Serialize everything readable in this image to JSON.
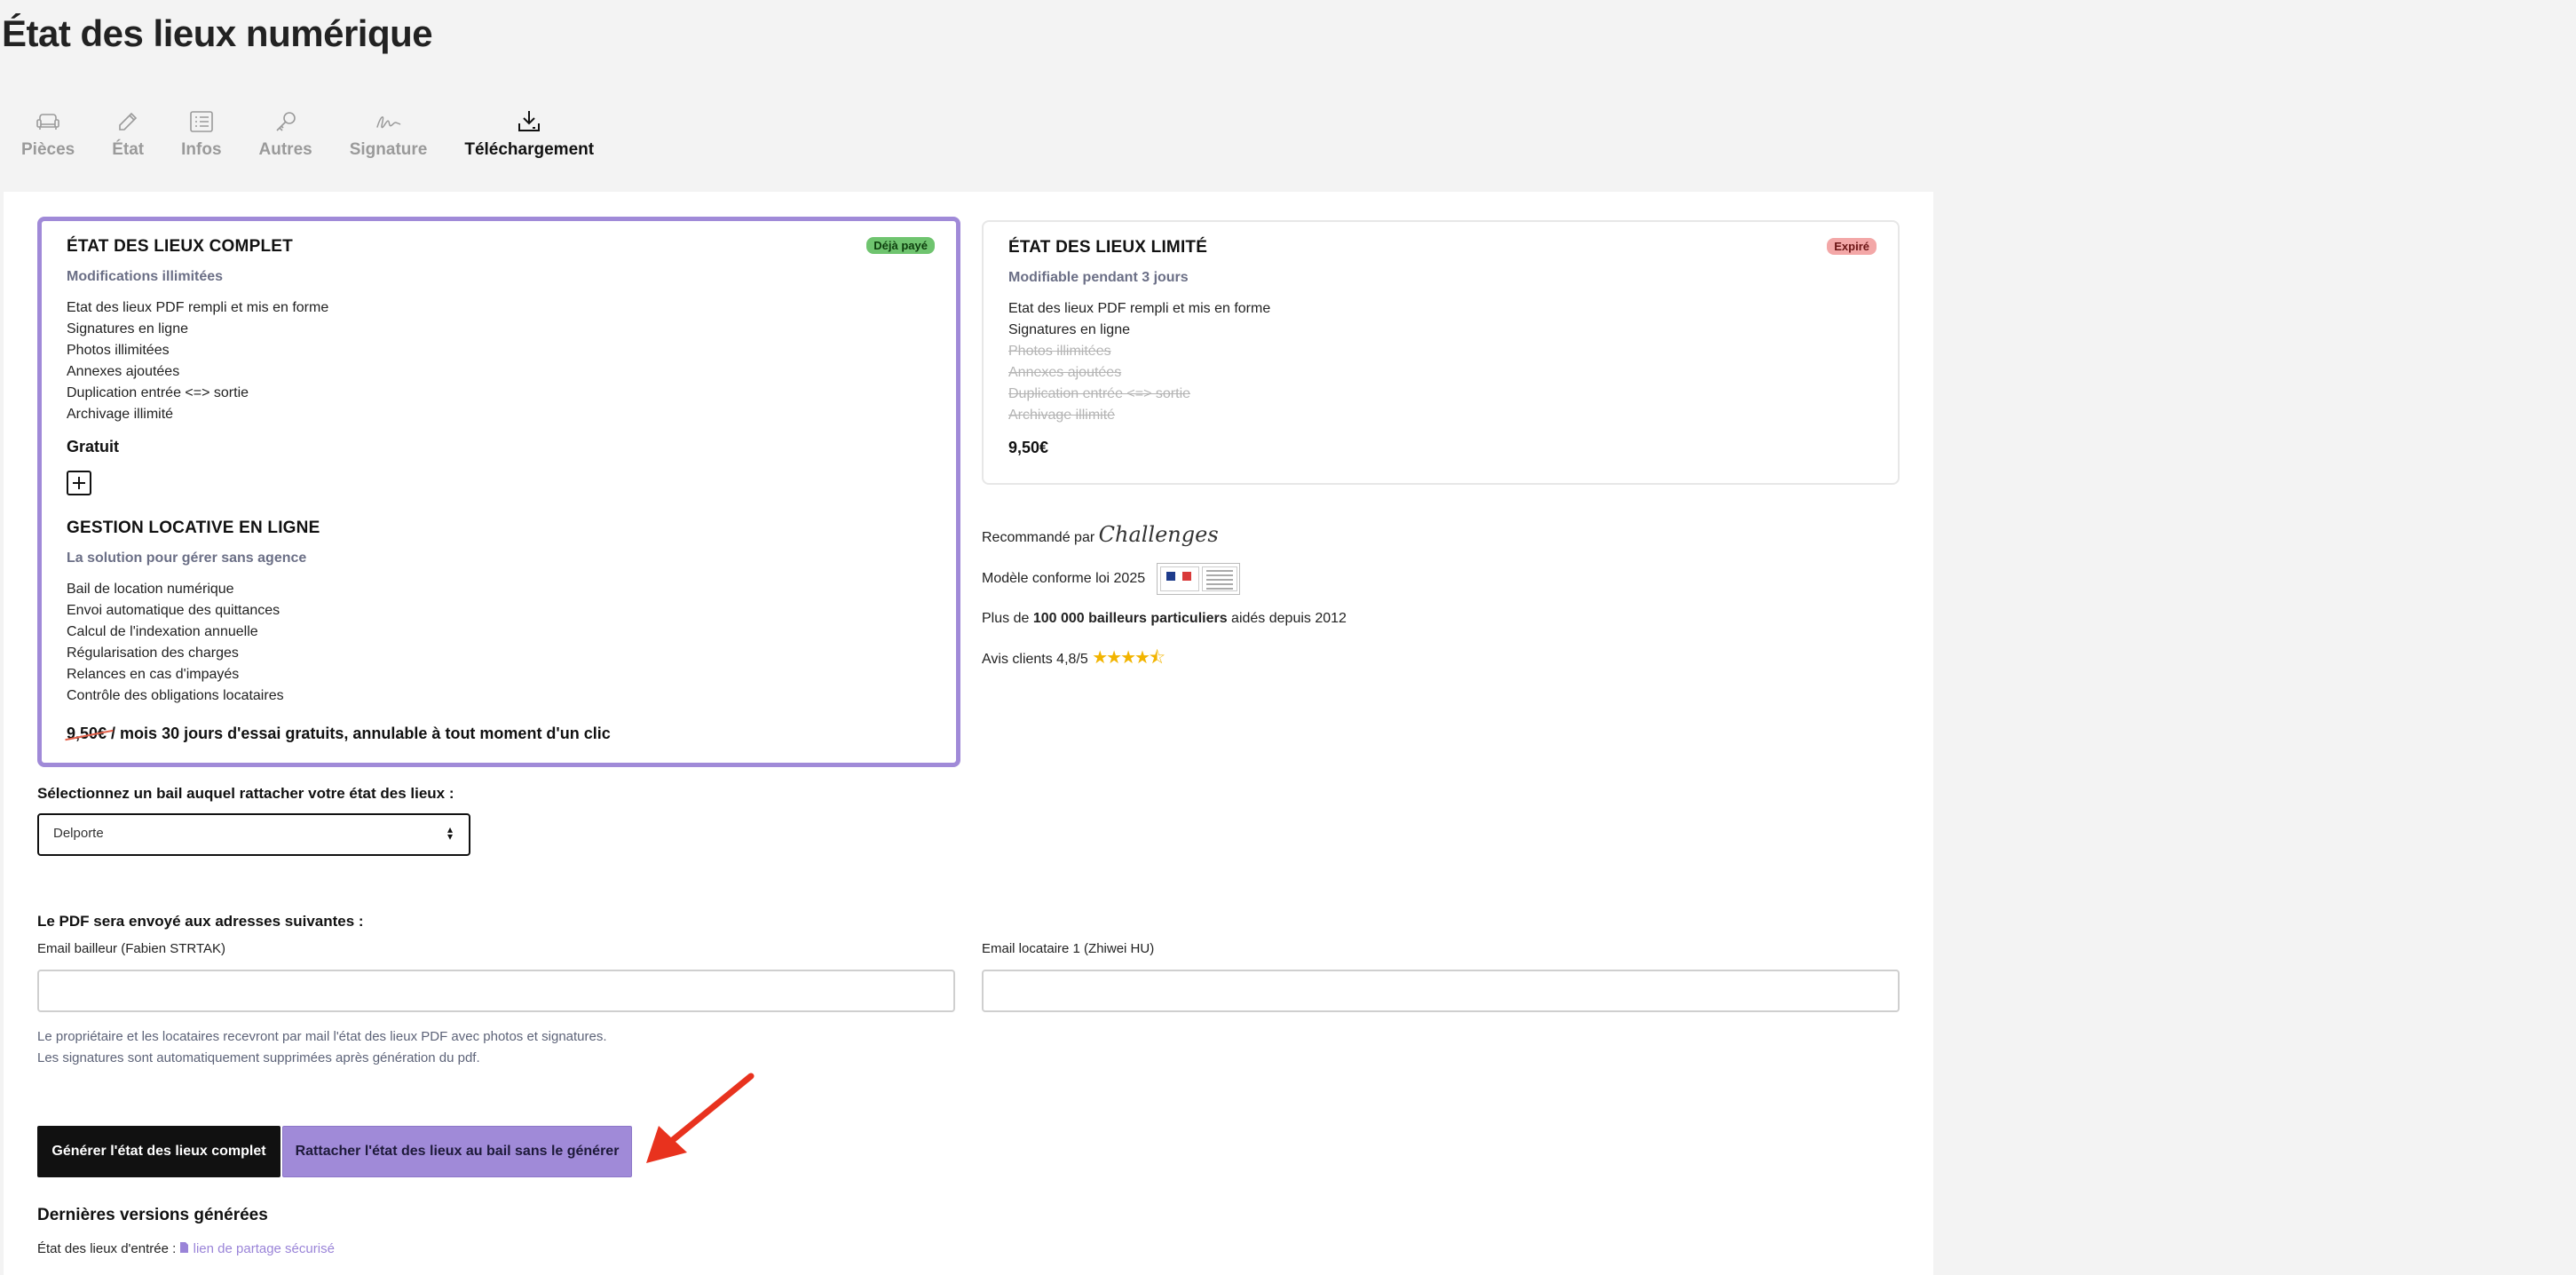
{
  "page_title": "État des lieux numérique",
  "tabs": [
    {
      "label": "Pièces",
      "icon": "sofa-icon"
    },
    {
      "label": "État",
      "icon": "pencil-icon"
    },
    {
      "label": "Infos",
      "icon": "list-icon"
    },
    {
      "label": "Autres",
      "icon": "key-icon"
    },
    {
      "label": "Signature",
      "icon": "signature-icon"
    },
    {
      "label": "Téléchargement",
      "icon": "download-icon",
      "active": true
    }
  ],
  "complete_card": {
    "title": "ÉTAT DES LIEUX COMPLET",
    "badge": "Déjà payé",
    "subtitle": "Modifications illimitées",
    "features": [
      "Etat des lieux PDF rempli et mis en forme",
      "Signatures en ligne",
      "Photos illimitées",
      "Annexes ajoutées",
      "Duplication entrée <=> sortie",
      "Archivage illimité"
    ],
    "price": "Gratuit",
    "gestion": {
      "title": "GESTION LOCATIVE EN LIGNE",
      "subtitle": "La solution pour gérer sans agence",
      "features": [
        "Bail de location numérique",
        "Envoi automatique des quittances",
        "Calcul de l'indexation annuelle",
        "Régularisation des charges",
        "Relances en cas d'impayés",
        "Contrôle des obligations locataires"
      ],
      "old_price": "9,50€",
      "trial_text": " / mois 30 jours d'essai gratuits, annulable à tout moment d'un clic"
    }
  },
  "limited_card": {
    "title": "ÉTAT DES LIEUX LIMITÉ",
    "badge": "Expiré",
    "subtitle": "Modifiable pendant 3 jours",
    "features": [
      "Etat des lieux PDF rempli et mis en forme",
      "Signatures en ligne"
    ],
    "struck_features": [
      "Photos illimitées",
      "Annexes ajoutées",
      "Duplication entrée <=> sortie",
      "Archivage illimité"
    ],
    "price": "9,50€"
  },
  "trust": {
    "recommended_label": "Recommandé par",
    "challenges_logo": "Challenges",
    "conforme_label": "Modèle conforme loi 2025",
    "bailleurs_prefix": "Plus de ",
    "bailleurs_bold": "100 000 bailleurs particuliers",
    "bailleurs_suffix": " aidés depuis 2012",
    "reviews_label": "Avis clients 4,8/5",
    "rating": 4.8
  },
  "bail_select": {
    "label": "Sélectionnez un bail auquel rattacher votre état des lieux :",
    "value": "Delporte"
  },
  "pdf_section": {
    "label": "Le PDF sera envoyé aux adresses suivantes :",
    "landlord_email_label": "Email bailleur (Fabien STRTAK)",
    "landlord_email_value": "",
    "tenant_email_label": "Email locataire 1 (Zhiwei HU)",
    "tenant_email_value": "",
    "help_line1": "Le propriétaire et les locataires recevront par mail l'état des lieux PDF avec photos et signatures.",
    "help_line2": "Les signatures sont automatiquement supprimées après génération du pdf."
  },
  "buttons": {
    "generate": "Générer l'état des lieux complet",
    "attach": "Rattacher l'état des lieux au bail sans le générer"
  },
  "versions": {
    "title": "Dernières versions générées",
    "entry_label": "État des lieux d'entrée : ",
    "entry_link": "lien de partage sécurisé"
  },
  "colors": {
    "accent_purple": "#a08ad8",
    "paid_badge": "#6fc46f",
    "expired_badge": "#f3a7a7",
    "arrow_red": "#e8321e"
  }
}
